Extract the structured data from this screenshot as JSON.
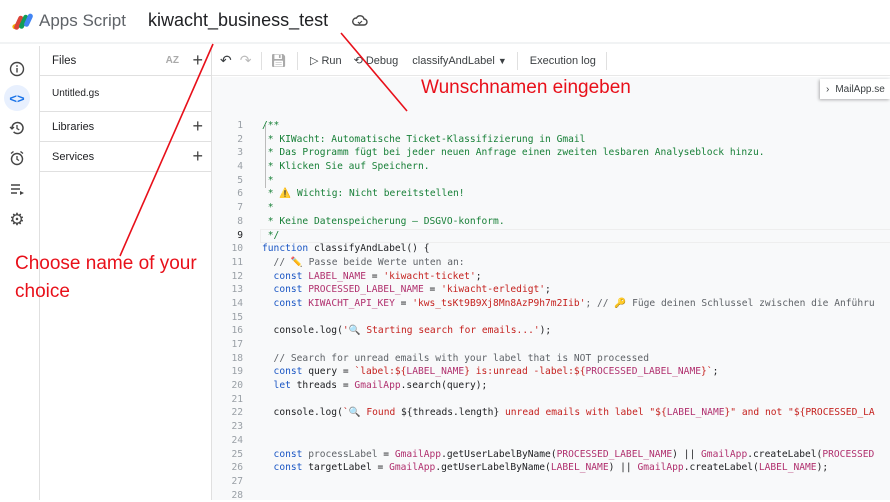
{
  "app": {
    "name": "Apps Script",
    "project_name": "kiwacht_business_test"
  },
  "files_panel": {
    "title": "Files",
    "files": [
      "Untitled.gs"
    ],
    "libraries": "Libraries",
    "services": "Services"
  },
  "toolbar": {
    "run": "Run",
    "debug": "Debug",
    "function": "classifyAndLabel",
    "execution_log": "Execution log"
  },
  "side_tab": "MailApp.se",
  "annotations": {
    "top": "Wunschnamen eingeben",
    "left": "Choose name of your choice",
    "color": "#e8101a"
  },
  "current_line": 9,
  "code_lines": [
    [
      [
        "/**",
        "c"
      ]
    ],
    [
      [
        " * KIWacht: Automatische Ticket-Klassifizierung in Gmail",
        "c"
      ]
    ],
    [
      [
        " * Das Programm fügt bei jeder neuen Anfrage einen zweiten lesbaren Analyseblock hinzu.",
        "c"
      ]
    ],
    [
      [
        " * Klicken Sie auf Speichern.",
        "c"
      ]
    ],
    [
      [
        " *",
        "c"
      ]
    ],
    [
      [
        " * ⚠️ Wichtig: Nicht bereitstellen!",
        "c"
      ]
    ],
    [
      [
        " *",
        "c"
      ]
    ],
    [
      [
        " * Keine Datenspeicherung – DSGVO-konform.",
        "c"
      ]
    ],
    [
      [
        " */",
        "c"
      ]
    ],
    [
      [
        "function ",
        "k"
      ],
      [
        "classifyAndLabel() {",
        "p"
      ]
    ],
    [
      [
        "  // ✏️ Passe beide Werte unten an:",
        "g"
      ]
    ],
    [
      [
        "  const ",
        "k"
      ],
      [
        "LABEL_NAME",
        "v"
      ],
      [
        " = ",
        "p"
      ],
      [
        "'kiwacht-ticket'",
        "s"
      ],
      [
        ";",
        "p"
      ]
    ],
    [
      [
        "  const ",
        "k"
      ],
      [
        "PROCESSED_LABEL_NAME",
        "v"
      ],
      [
        " = ",
        "p"
      ],
      [
        "'kiwacht-erledigt'",
        "s"
      ],
      [
        ";",
        "p"
      ]
    ],
    [
      [
        "  const ",
        "k"
      ],
      [
        "KIWACHT_API_KEY",
        "v"
      ],
      [
        " = ",
        "p"
      ],
      [
        "'kws_tsKt9B9Xj8Mn8AzP9h7m2Iib'",
        "s"
      ],
      [
        "; // 🔑 Füge deinen Schlussel zwischen die Anführu",
        "g"
      ]
    ],
    [],
    [
      [
        "  console.log(",
        "p"
      ],
      [
        "'🔍 Starting search for emails...'",
        "s"
      ],
      [
        ");",
        "p"
      ]
    ],
    [],
    [
      [
        "  // Search for unread emails with your label that is NOT processed",
        "g"
      ]
    ],
    [
      [
        "  const ",
        "k"
      ],
      [
        "query = ",
        "p"
      ],
      [
        "`label:${",
        "s"
      ],
      [
        "LABEL_NAME",
        "v"
      ],
      [
        "} is:unread -label:${",
        "s"
      ],
      [
        "PROCESSED_LABEL_NAME",
        "v"
      ],
      [
        "}`",
        "s"
      ],
      [
        ";",
        "p"
      ]
    ],
    [
      [
        "  let ",
        "k"
      ],
      [
        "threads = ",
        "p"
      ],
      [
        "GmailApp",
        "v"
      ],
      [
        ".search(query);",
        "p"
      ]
    ],
    [],
    [
      [
        "  console.log(",
        "p"
      ],
      [
        "`🔍 Found ",
        "s"
      ],
      [
        "${threads.length}",
        "p"
      ],
      [
        " unread emails with label \"${",
        "s"
      ],
      [
        "LABEL_NAME",
        "v"
      ],
      [
        "}\" and not \"${PROCESSED_LA",
        "s"
      ]
    ],
    [],
    [],
    [
      [
        "  const ",
        "k"
      ],
      [
        "processLabel",
        "g"
      ],
      [
        " = ",
        "p"
      ],
      [
        "GmailApp",
        "v"
      ],
      [
        ".getUserLabelByName(",
        "p"
      ],
      [
        "PROCESSED_LABEL_NAME",
        "v"
      ],
      [
        ") || ",
        "p"
      ],
      [
        "GmailApp",
        "v"
      ],
      [
        ".createLabel(",
        "p"
      ],
      [
        "PROCESSED",
        "v"
      ]
    ],
    [
      [
        "  const ",
        "k"
      ],
      [
        "targetLabel = ",
        "p"
      ],
      [
        "GmailApp",
        "v"
      ],
      [
        ".getUserLabelByName(",
        "p"
      ],
      [
        "LABEL_NAME",
        "v"
      ],
      [
        ") || ",
        "p"
      ],
      [
        "GmailApp",
        "v"
      ],
      [
        ".createLabel(",
        "p"
      ],
      [
        "LABEL_NAME",
        "v"
      ],
      [
        ");",
        "p"
      ]
    ],
    [],
    []
  ]
}
